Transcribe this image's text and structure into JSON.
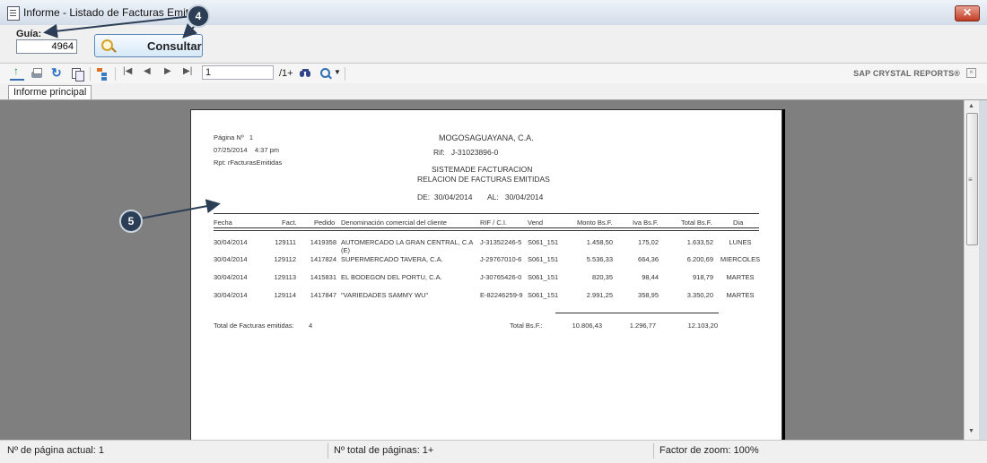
{
  "window": {
    "title": "Informe -  Listado de Facturas Emitidas",
    "close_label": "✕"
  },
  "form": {
    "guia_label": "Guía:",
    "guia_value": "4964",
    "consultar_label": "Consultar"
  },
  "toolbar": {
    "page_value": "1",
    "page_total": "/1+",
    "brand": "SAP CRYSTAL REPORTS®",
    "icons": [
      "export-icon",
      "print-icon",
      "refresh-icon",
      "copy-icon",
      "group-tree-icon",
      "first-page-icon",
      "prev-page-icon",
      "next-page-icon",
      "last-page-icon",
      "find-icon",
      "zoom-icon"
    ]
  },
  "tab": {
    "label": "Informe principal"
  },
  "report": {
    "page_label": "Página Nº",
    "page_num": "1",
    "date": "07/25/2014",
    "time": "4:37 pm",
    "rpt": "Rpt:  rFacturasEmitidas",
    "company": "MOGOSAGUAYANA, C.A.",
    "rif_label": "Rif:",
    "rif_value": "J-31023896-0",
    "system": "SISTEMADE FACTURACION",
    "subtitle": "RELACION DE FACTURAS EMITIDAS",
    "de_label": "DE:",
    "de_value": "30/04/2014",
    "al_label": "AL:",
    "al_value": "30/04/2014",
    "headers": [
      "Fecha",
      "Fact.",
      "Pedido",
      "Denominación comercial del cliente",
      "RIF / C.I.",
      "Vend",
      "Monto Bs.F.",
      "Iva Bs.F.",
      "Total Bs.F.",
      "Dia"
    ],
    "rows": [
      {
        "fecha": "30/04/2014",
        "fact": "129111",
        "pedido": "1419358",
        "cliente": "AUTOMERCADO LA GRAN CENTRAL, C.A",
        "cliente2": "(E)",
        "rif": "J-31352246-5",
        "vend": "S061_151",
        "monto": "1.458,50",
        "iva": "175,02",
        "total": "1.633,52",
        "dia": "LUNES"
      },
      {
        "fecha": "30/04/2014",
        "fact": "129112",
        "pedido": "1417824",
        "cliente": "SUPERMERCADO TAVERA, C.A.",
        "cliente2": "",
        "rif": "J-29767010-6",
        "vend": "S061_151",
        "monto": "5.536,33",
        "iva": "664,36",
        "total": "6.200,69",
        "dia": "MIERCOLES"
      },
      {
        "fecha": "30/04/2014",
        "fact": "129113",
        "pedido": "1415831",
        "cliente": "EL BODEGON DEL PORTU, C.A.",
        "cliente2": "",
        "rif": "J-30765426-0",
        "vend": "S061_151",
        "monto": "820,35",
        "iva": "98,44",
        "total": "918,79",
        "dia": "MARTES"
      },
      {
        "fecha": "30/04/2014",
        "fact": "129114",
        "pedido": "1417847",
        "cliente": "\"VARIEDADES SAMMY WU\"",
        "cliente2": "",
        "rif": "E-82246259-9",
        "vend": "S061_151",
        "monto": "2.991,25",
        "iva": "358,95",
        "total": "3.350,20",
        "dia": "MARTES"
      }
    ],
    "total_facturas_label": "Total de Facturas emitidas:",
    "total_facturas_value": "4",
    "total_bs_label": "Total Bs.F.:",
    "total_monto": "10.806,43",
    "total_iva": "1.296,77",
    "total_total": "12.103,20"
  },
  "status": {
    "current_page": "Nº de página actual: 1",
    "total_pages": "Nº total de páginas: 1+",
    "zoom": "Factor de zoom: 100%"
  },
  "callouts": [
    "4",
    "5"
  ]
}
